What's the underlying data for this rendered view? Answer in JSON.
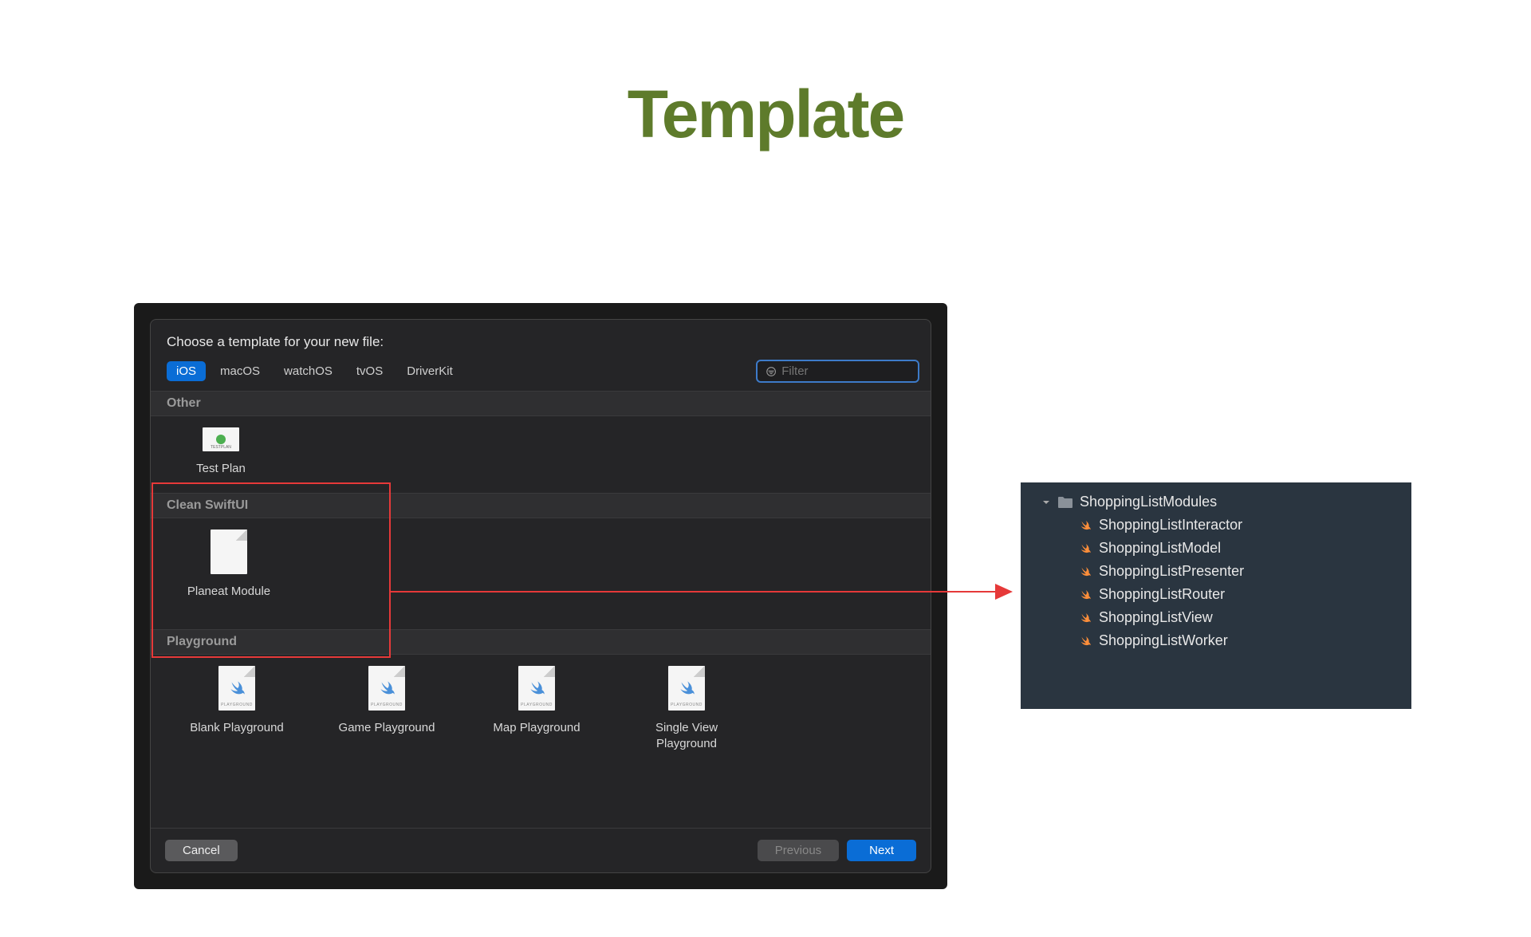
{
  "slide": {
    "title": "Template"
  },
  "dialog": {
    "header": "Choose a template for your new file:",
    "tabs": [
      "iOS",
      "macOS",
      "watchOS",
      "tvOS",
      "DriverKit"
    ],
    "active_tab_index": 0,
    "filter_placeholder": "Filter",
    "sections": {
      "other": {
        "title": "Other",
        "items": [
          {
            "label": "Test Plan"
          }
        ]
      },
      "clean_swiftui": {
        "title": "Clean SwiftUI",
        "items": [
          {
            "label": "Planeat Module"
          }
        ]
      },
      "playground": {
        "title": "Playground",
        "items": [
          {
            "label": "Blank Playground"
          },
          {
            "label": "Game Playground"
          },
          {
            "label": "Map Playground"
          },
          {
            "label": "Single View Playground"
          }
        ]
      }
    },
    "buttons": {
      "cancel": "Cancel",
      "previous": "Previous",
      "next": "Next"
    }
  },
  "file_tree": {
    "folder": "ShoppingListModules",
    "files": [
      "ShoppingListInteractor",
      "ShoppingListModel",
      "ShoppingListPresenter",
      "ShoppingListRouter",
      "ShoppingListView",
      "ShoppingListWorker"
    ]
  }
}
